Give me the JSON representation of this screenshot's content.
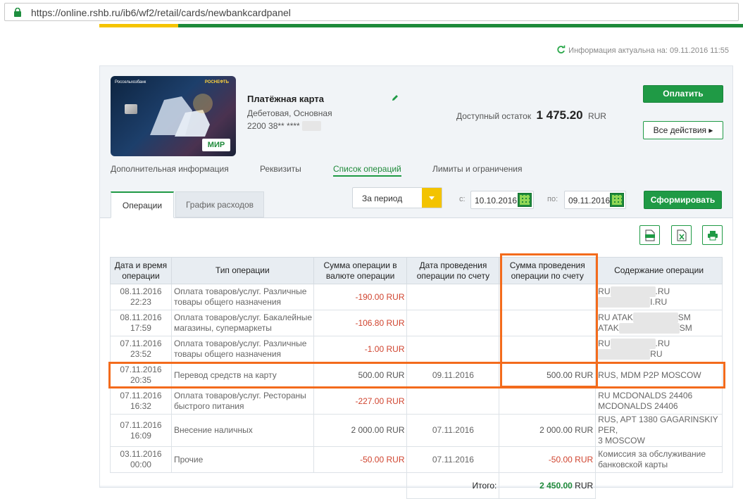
{
  "browser": {
    "url": "https://online.rshb.ru/ib6/wf2/retail/cards/newbankcardpanel"
  },
  "info": {
    "text": "Информация актуальна на: 09.11.2016 11:55"
  },
  "card": {
    "bank_label": "Россельхозбанк",
    "partner_label": "РОСНЕФТЬ",
    "mir_label": "МИР",
    "title": "Платёжная карта",
    "subtitle": "Дебетовая, Основная",
    "number": "2200 38** ****",
    "balance_label": "Доступный остаток",
    "balance_value": "1 475.20",
    "balance_currency": "RUR"
  },
  "actions": {
    "pay": "Оплатить",
    "all": "Все действия ▸"
  },
  "subnav": [
    "Дополнительная информация",
    "Реквизиты",
    "Список операций",
    "Лимиты и ограничения"
  ],
  "tabs": {
    "operations": "Операции",
    "chart": "График расходов"
  },
  "filter": {
    "period": "За период",
    "from_label": "с:",
    "from": "10.10.2016",
    "to_label": "по:",
    "to": "09.11.2016",
    "submit": "Сформировать"
  },
  "table": {
    "headers": [
      "Дата и время операции",
      "Тип операции",
      "Сумма операции в валюте операции",
      "Дата проведения операции по счету",
      "Сумма проведения операции по счету",
      "Содержание операции"
    ],
    "rows": [
      {
        "date": "08.11.2016",
        "time": "22:23",
        "type": "Оплата товаров/услуг. Различные товары общего назначения",
        "amount": "-190.00 RUR",
        "post_date": "",
        "post_amount": "",
        "desc1": "RU",
        "desc1b": ".RU",
        "desc2": "",
        "desc2b": "I.RU"
      },
      {
        "date": "08.11.2016",
        "time": "17:59",
        "type": "Оплата товаров/услуг. Бакалейные магазины, супермаркеты",
        "amount": "-106.80 RUR",
        "post_date": "",
        "post_amount": "",
        "desc1": "RU ATAK",
        "desc1b": "SM",
        "desc2": "ATAK",
        "desc2b": "SM"
      },
      {
        "date": "07.11.2016",
        "time": "23:52",
        "type": "Оплата товаров/услуг. Различные товары общего назначения",
        "amount": "-1.00 RUR",
        "post_date": "",
        "post_amount": "",
        "desc1": "RU",
        "desc1b": ".RU",
        "desc2": "",
        "desc2b": "RU"
      },
      {
        "date": "07.11.2016",
        "time": "20:35",
        "type": "Перевод средств на карту",
        "amount": "500.00 RUR",
        "post_date": "09.11.2016",
        "post_amount": "500.00 RUR",
        "desc1": "RUS, MDM P2P MOSCOW",
        "desc1b": "",
        "desc2": "",
        "desc2b": ""
      },
      {
        "date": "07.11.2016",
        "time": "16:32",
        "type": "Оплата товаров/услуг. Рестораны быстрого питания",
        "amount": "-227.00 RUR",
        "post_date": "",
        "post_amount": "",
        "desc1": "RU MCDONALDS 24406",
        "desc1b": "",
        "desc2": "MCDONALDS 24406",
        "desc2b": ""
      },
      {
        "date": "07.11.2016",
        "time": "16:09",
        "type": "Внесение наличных",
        "amount": "2 000.00 RUR",
        "post_date": "07.11.2016",
        "post_amount": "2 000.00 RUR",
        "desc1": "RUS, APT 1380 GAGARINSKIY PER,",
        "desc1b": "",
        "desc2": "3 MOSCOW",
        "desc2b": ""
      },
      {
        "date": "03.11.2016",
        "time": "00:00",
        "type": "Прочие",
        "amount": "-50.00 RUR",
        "post_date": "07.11.2016",
        "post_amount": "-50.00 RUR",
        "desc1": "Комиссия за обслуживание",
        "desc1b": "",
        "desc2": "банковской карты",
        "desc2b": ""
      }
    ],
    "total_label": "Итого:",
    "total_value": "2 450.00",
    "total_currency": "RUR"
  },
  "colors": {
    "brand_green": "#1f9a45",
    "negative": "#d0442f",
    "highlight": "#f36b1c",
    "accent_yellow": "#f3c300"
  }
}
